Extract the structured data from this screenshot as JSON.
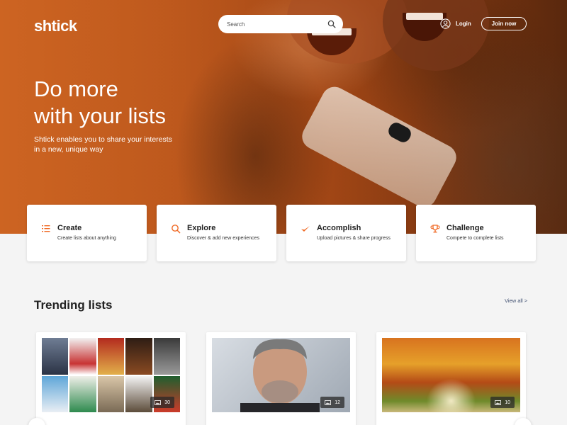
{
  "brand": {
    "logo": "shtick",
    "accent": "#f06a25"
  },
  "header": {
    "search_placeholder": "Search",
    "login_label": "Login",
    "join_label": "Join now"
  },
  "hero": {
    "title_line1": "Do more",
    "title_line2": "with your lists",
    "subtitle": "Shtick enables you to share your interests in a new, unique way"
  },
  "features": [
    {
      "icon": "list-icon",
      "title": "Create",
      "desc": "Create lists about anything"
    },
    {
      "icon": "search-icon",
      "title": "Explore",
      "desc": "Discover & add new experiences"
    },
    {
      "icon": "check-icon",
      "title": "Accomplish",
      "desc": "Upload pictures & share progress"
    },
    {
      "icon": "trophy-icon",
      "title": "Challenge",
      "desc": "Compete to complete lists"
    }
  ],
  "trending": {
    "title": "Trending lists",
    "view_all": "View all >",
    "lists": [
      {
        "image": "movie-posters-collage",
        "count": "30"
      },
      {
        "image": "man-portrait",
        "count": "12"
      },
      {
        "image": "autumn-tree-avenue",
        "count": "10"
      }
    ]
  }
}
